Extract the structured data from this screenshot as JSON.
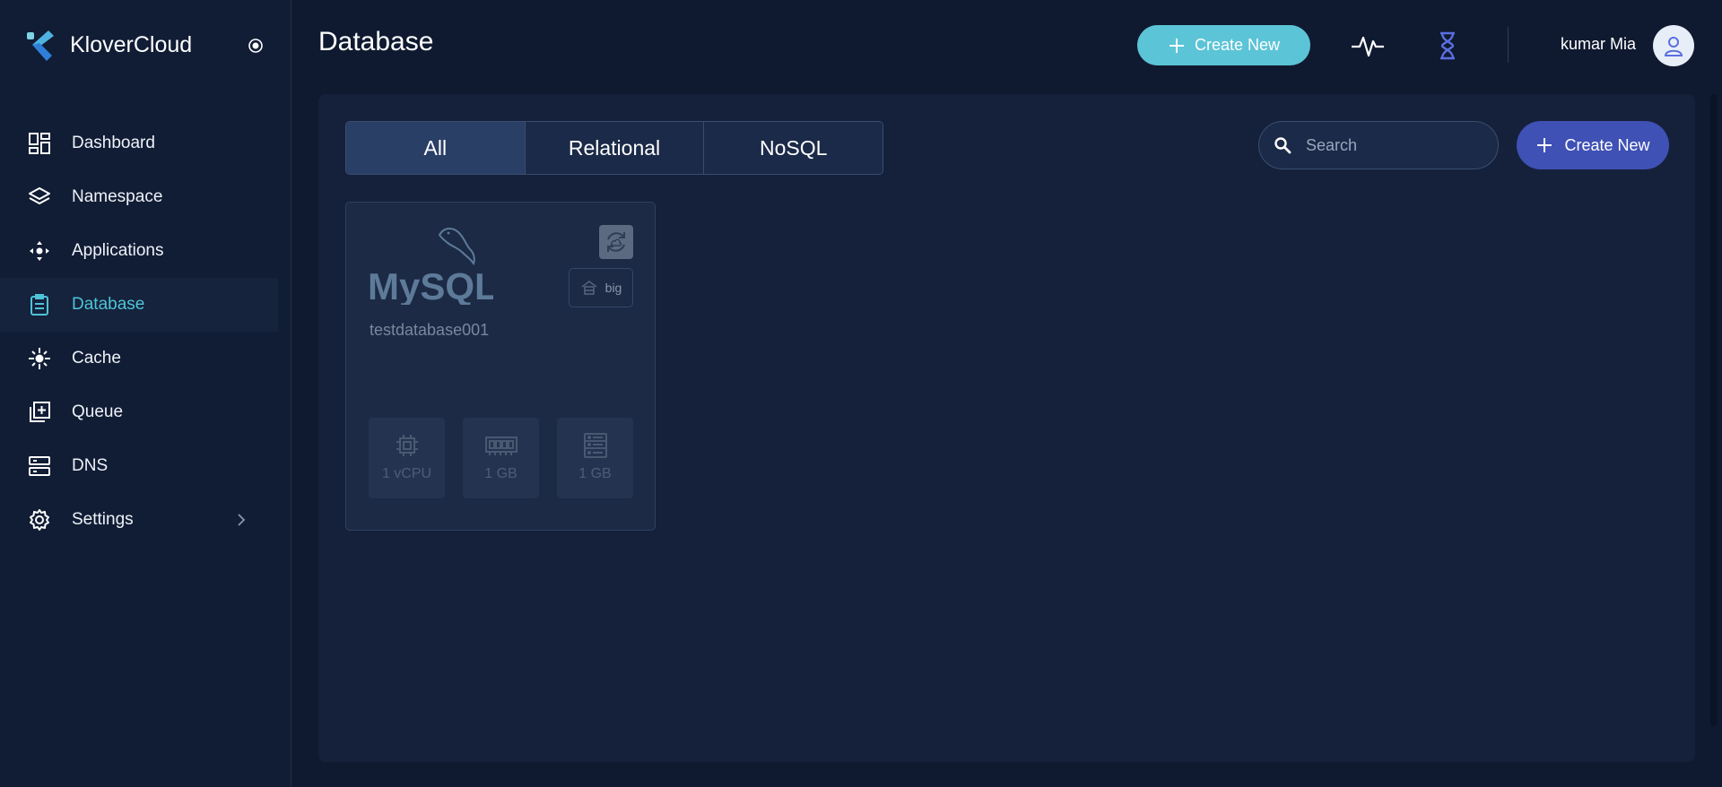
{
  "app": {
    "name": "KloverCloud"
  },
  "sidebar": {
    "items": [
      {
        "label": "Dashboard",
        "icon": "dashboard-icon"
      },
      {
        "label": "Namespace",
        "icon": "layers-icon"
      },
      {
        "label": "Applications",
        "icon": "applications-icon"
      },
      {
        "label": "Database",
        "icon": "clipboard-icon"
      },
      {
        "label": "Cache",
        "icon": "cache-icon"
      },
      {
        "label": "Queue",
        "icon": "queue-icon"
      },
      {
        "label": "DNS",
        "icon": "server-icon"
      },
      {
        "label": "Settings",
        "icon": "gear-icon"
      }
    ],
    "active": "Database"
  },
  "header": {
    "title": "Database",
    "create_label": "Create New",
    "user_name": "kumar Mia"
  },
  "toolbar": {
    "tabs": [
      {
        "label": "All"
      },
      {
        "label": "Relational"
      },
      {
        "label": "NoSQL"
      }
    ],
    "active_tab": "All",
    "search_placeholder": "Search",
    "create_label": "Create New"
  },
  "databases": [
    {
      "logo_text": "MySQL",
      "name": "testdatabase001",
      "size_badge": "big",
      "resources": [
        {
          "label": "1 vCPU",
          "icon": "cpu-icon"
        },
        {
          "label": "1 GB",
          "icon": "memory-icon"
        },
        {
          "label": "1 GB",
          "icon": "storage-icon"
        }
      ]
    }
  ],
  "colors": {
    "accent_teal": "#5bc4d6",
    "primary_indigo": "#3f51b5",
    "active_nav": "#4fc3d8",
    "mysql_blue": "#5d7a99",
    "mysql_orange": "#e48e00"
  }
}
